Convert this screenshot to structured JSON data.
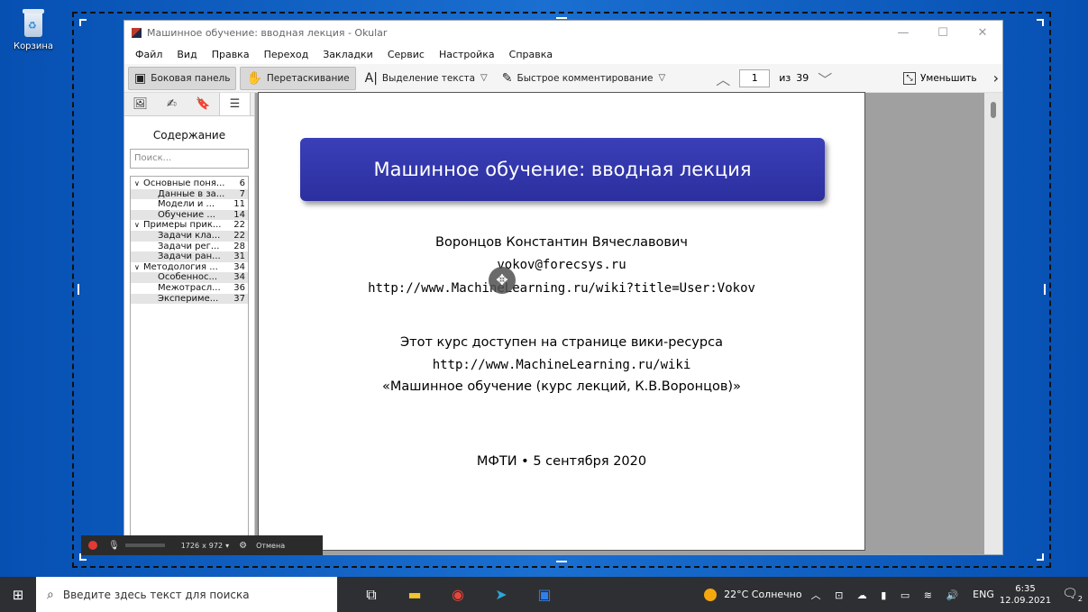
{
  "desktop": {
    "recycle_bin_label": "Корзина"
  },
  "window": {
    "title": "Машинное обучение: вводная лекция  - Okular",
    "controls": [
      "—",
      "☐",
      "✕"
    ]
  },
  "menu": [
    "Файл",
    "Вид",
    "Правка",
    "Переход",
    "Закладки",
    "Сервис",
    "Настройка",
    "Справка"
  ],
  "toolbar": {
    "sidebar_label": "Боковая панель",
    "drag_label": "Перетаскивание",
    "text_select_label": "Выделение текста",
    "quick_comment_label": "Быстрое комментирование",
    "page_value": "1",
    "of_label": "из",
    "page_total": "39",
    "zoom_out_label": "Уменьшить"
  },
  "sidebar": {
    "title": "Содержание",
    "search_placeholder": "Поиск...",
    "toc": [
      {
        "level": 0,
        "title": "Основные поня...",
        "page": "6",
        "shade": false
      },
      {
        "level": 1,
        "title": "Данные в за...",
        "page": "7",
        "shade": true
      },
      {
        "level": 1,
        "title": "Модели и ...",
        "page": "11",
        "shade": false
      },
      {
        "level": 1,
        "title": "Обучение ...",
        "page": "14",
        "shade": true
      },
      {
        "level": 0,
        "title": "Примеры прик...",
        "page": "22",
        "shade": false
      },
      {
        "level": 1,
        "title": "Задачи кла...",
        "page": "22",
        "shade": true
      },
      {
        "level": 1,
        "title": "Задачи рег...",
        "page": "28",
        "shade": false
      },
      {
        "level": 1,
        "title": "Задачи ран...",
        "page": "31",
        "shade": true
      },
      {
        "level": 0,
        "title": "Методология ...",
        "page": "34",
        "shade": false
      },
      {
        "level": 1,
        "title": "Особеннос...",
        "page": "34",
        "shade": true
      },
      {
        "level": 1,
        "title": "Межотрасл...",
        "page": "36",
        "shade": false
      },
      {
        "level": 1,
        "title": "Экспериме...",
        "page": "37",
        "shade": true
      }
    ]
  },
  "slide": {
    "title": "Машинное обучение: вводная лекция",
    "author": "Воронцов Константин Вячеславович",
    "email": "vokov@forecsys.ru",
    "url": "http://www.MachineLearning.ru/wiki?title=User:Vokov",
    "course_line": "Этот курс доступен на странице вики-ресурса",
    "wiki_url": "http://www.MachineLearning.ru/wiki",
    "course_title": "«Машинное обучение (курс лекций, К.В.Воронцов)»",
    "footer": "МФТИ  •  5 сентября 2020"
  },
  "recorder": {
    "width": "1726",
    "x": "x",
    "height": "972",
    "cancel_label": "Отмена"
  },
  "taskbar": {
    "search_placeholder": "Введите здесь текст для поиска",
    "weather": "22°C  Солнечно",
    "lang": "ENG",
    "time": "6:35",
    "date": "12.09.2021",
    "notif_count": "2"
  }
}
